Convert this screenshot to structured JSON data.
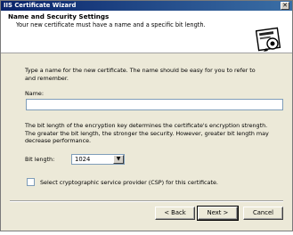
{
  "window": {
    "title": "IIS Certificate Wizard",
    "close_glyph": "✕"
  },
  "header": {
    "title": "Name and Security Settings",
    "description": "Your new certificate must have a name and a specific bit length."
  },
  "name_section": {
    "instruction_line1": "Type a name for the new certificate. The name should be easy for you to refer to",
    "instruction_line2": "and remember.",
    "label": "Name:",
    "value": ""
  },
  "bitlength_section": {
    "description_line1": "The bit length of the encryption key determines the certificate's encryption strength.",
    "description_line2": "The greater the bit length, the stronger the security. However, greater bit length may",
    "description_line3": "decrease performance.",
    "label": "Bit length:",
    "selected": "1024",
    "arrow_glyph": "▼"
  },
  "csp_checkbox": {
    "label": "Select cryptographic service provider (CSP) for this certificate.",
    "checked": false
  },
  "buttons": {
    "back": "< Back",
    "next": "Next >",
    "cancel": "Cancel"
  }
}
